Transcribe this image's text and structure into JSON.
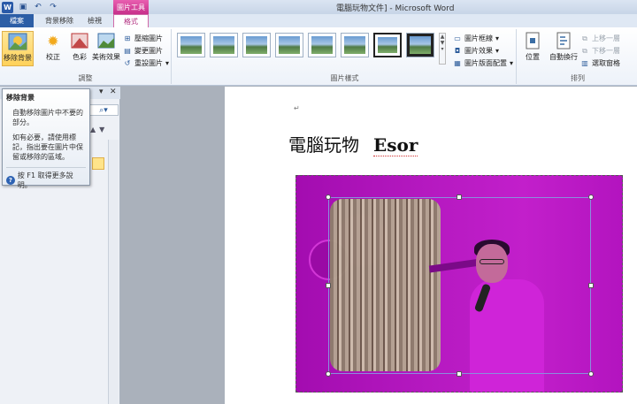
{
  "window": {
    "title": "電腦玩物文件] - Microsoft Word",
    "context_tab": "圖片工具",
    "qat_icons": [
      "word-icon",
      "save-icon",
      "undo-icon",
      "redo-icon"
    ]
  },
  "tabs": {
    "file": "檔案",
    "background_removal": "背景移除",
    "view": "檢視",
    "format": "格式"
  },
  "ribbon": {
    "adjust": {
      "label": "調整",
      "remove_background": "移除背景",
      "corrections": "校正",
      "color": "色彩",
      "artistic": "美術效果",
      "compress": "壓縮圖片",
      "change": "變更圖片",
      "reset": "重設圖片"
    },
    "styles": {
      "label": "圖片樣式",
      "border": "圖片框線",
      "effects": "圖片效果",
      "layout": "圖片版面配置"
    },
    "arrange": {
      "label": "排列",
      "position": "位置",
      "wrap": "自動換行",
      "forward": "上移一層",
      "backward": "下移一層",
      "selection_pane": "選取窗格"
    }
  },
  "tooltip": {
    "title": "移除背景",
    "line1": "自動移除圖片中不要的部分。",
    "line2": "如有必要，請使用標記，指出要在圖片中保留或移除的區域。",
    "help": "按 F1 取得更多說明。"
  },
  "document": {
    "heading_zh": "電腦玩物",
    "heading_en": "Esor"
  },
  "colors": {
    "accent_pink": "#c72f8a",
    "file_tab_blue": "#2c5ea6",
    "removal_magenta": "#b519c0"
  }
}
